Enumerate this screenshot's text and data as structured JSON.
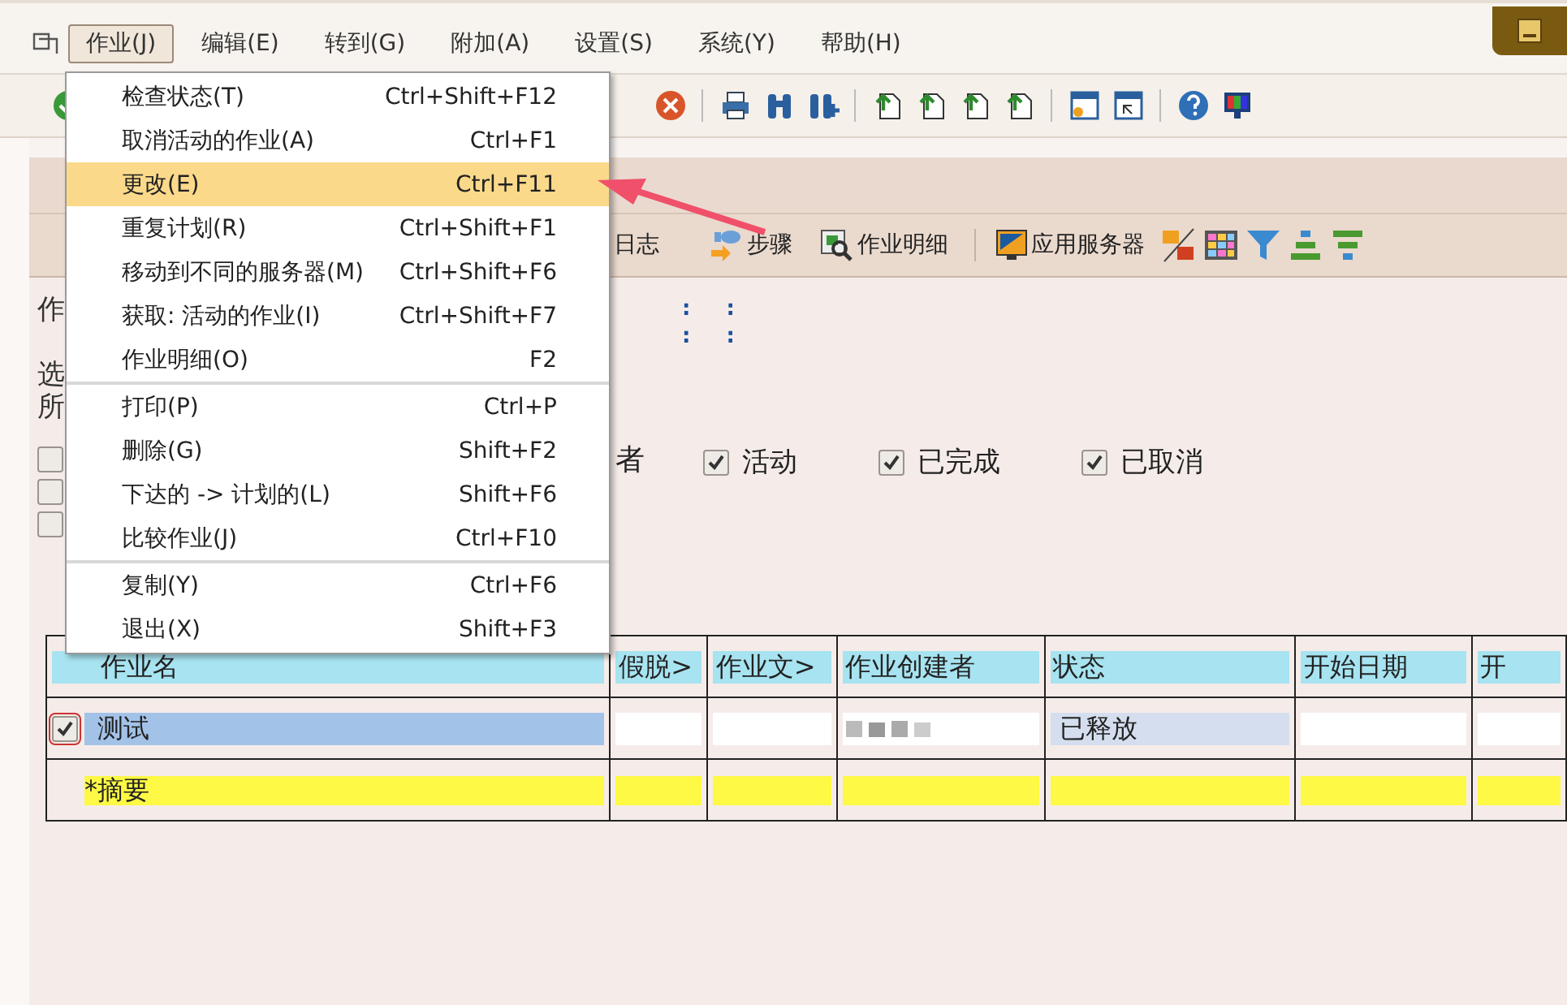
{
  "menubar": {
    "items": [
      {
        "label": "作业(J)",
        "selected": true
      },
      {
        "label": "编辑(E)",
        "selected": false
      },
      {
        "label": "转到(G)",
        "selected": false
      },
      {
        "label": "附加(A)",
        "selected": false
      },
      {
        "label": "设置(S)",
        "selected": false
      },
      {
        "label": "系统(Y)",
        "selected": false
      },
      {
        "label": "帮助(H)",
        "selected": false
      }
    ]
  },
  "menu": {
    "groups": [
      [
        {
          "label": "检查状态(T)",
          "shortcut": "Ctrl+Shift+F12",
          "selected": false
        },
        {
          "label": "取消活动的作业(A)",
          "shortcut": "Ctrl+F1",
          "selected": false
        },
        {
          "label": "更改(E)",
          "shortcut": "Ctrl+F11",
          "selected": true
        },
        {
          "label": "重复计划(R)",
          "shortcut": "Ctrl+Shift+F1",
          "selected": false
        },
        {
          "label": "移动到不同的服务器(M)",
          "shortcut": "Ctrl+Shift+F6",
          "selected": false
        },
        {
          "label": "获取: 活动的作业(I)",
          "shortcut": "Ctrl+Shift+F7",
          "selected": false
        },
        {
          "label": "作业明细(O)",
          "shortcut": "F2",
          "selected": false
        }
      ],
      [
        {
          "label": "打印(P)",
          "shortcut": "Ctrl+P",
          "selected": false
        },
        {
          "label": "删除(G)",
          "shortcut": "Shift+F2",
          "selected": false
        },
        {
          "label": "下达的 -> 计划的(L)",
          "shortcut": "Shift+F6",
          "selected": false
        },
        {
          "label": "比较作业(J)",
          "shortcut": "Ctrl+F10",
          "selected": false
        }
      ],
      [
        {
          "label": "复制(Y)",
          "shortcut": "Ctrl+F6",
          "selected": false
        },
        {
          "label": "退出(X)",
          "shortcut": "Shift+F3",
          "selected": false
        }
      ]
    ]
  },
  "app_toolbar": {
    "buttons": [
      {
        "label": "日志",
        "kind": "log"
      },
      {
        "label": "步骤",
        "kind": "steps"
      },
      {
        "label": "作业明细",
        "kind": "details"
      },
      {
        "label": "应用服务器",
        "kind": "server"
      }
    ]
  },
  "form": {
    "label_1": "作",
    "colons": [
      [
        ":",
        ":"
      ],
      [
        ":",
        ":"
      ]
    ],
    "label_2": "选",
    "label_3": "所",
    "left_checkboxes": [
      {
        "checked": false
      },
      {
        "checked": false
      },
      {
        "checked": false
      }
    ],
    "status_label": "者",
    "status_filters": [
      {
        "label": "活动",
        "checked": true
      },
      {
        "label": "已完成",
        "checked": true
      },
      {
        "label": "已取消",
        "checked": true
      }
    ]
  },
  "table": {
    "columns": [
      "作业名",
      "假脱>",
      "作业文>",
      "作业创建者",
      "状态",
      "开始日期",
      "开"
    ],
    "rows": [
      {
        "kind": "job",
        "checked": true,
        "name": "测试",
        "status": "已释放"
      },
      {
        "kind": "summary",
        "name": "*摘要"
      }
    ]
  }
}
